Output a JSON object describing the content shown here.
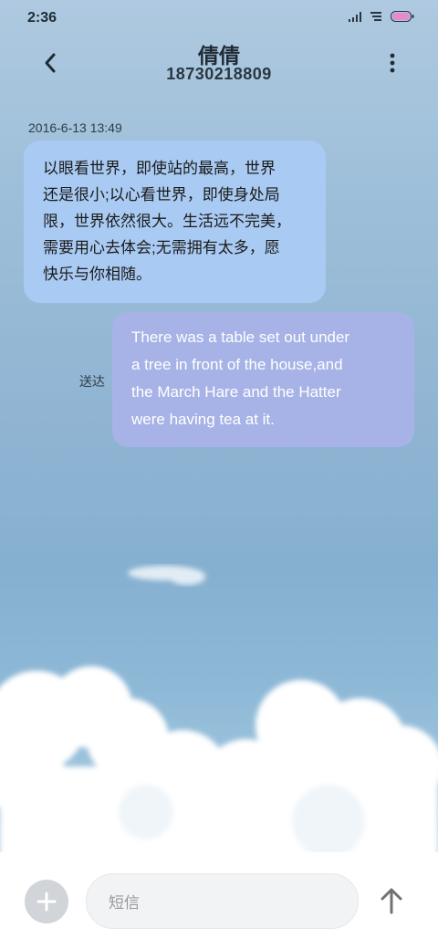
{
  "status_bar": {
    "time": "2:36",
    "icons": [
      "signal-icon",
      "wifi-icon",
      "battery-icon"
    ]
  },
  "header": {
    "contact_name": "倩倩",
    "contact_phone": "18730218809",
    "back_icon": "chevron-left-icon",
    "menu_icon": "more-vertical-icon"
  },
  "conversation": {
    "timestamp": "2016-6-13 13:49",
    "messages": [
      {
        "direction": "incoming",
        "lines": [
          "以眼看世界，即使站的最高，世界",
          "还是很小;以心看世界，即使身处局",
          "限，世界依然很大。生活远不完美，",
          "需要用心去体会;无需拥有太多，愿",
          "快乐与你相随。"
        ]
      },
      {
        "direction": "outgoing",
        "lines": [
          "There was a table set out under",
          "a tree in front of the house,and",
          "the March Hare and the Hatter",
          "were having tea at it."
        ],
        "status": "送达"
      }
    ]
  },
  "composer": {
    "placeholder": "短信",
    "attach_icon": "plus-icon",
    "send_icon": "arrow-up-icon"
  },
  "colors": {
    "incoming_bubble": "#a9caf2",
    "outgoing_bubble": "#a7b3e6",
    "composer_bg": "#ffffff"
  }
}
